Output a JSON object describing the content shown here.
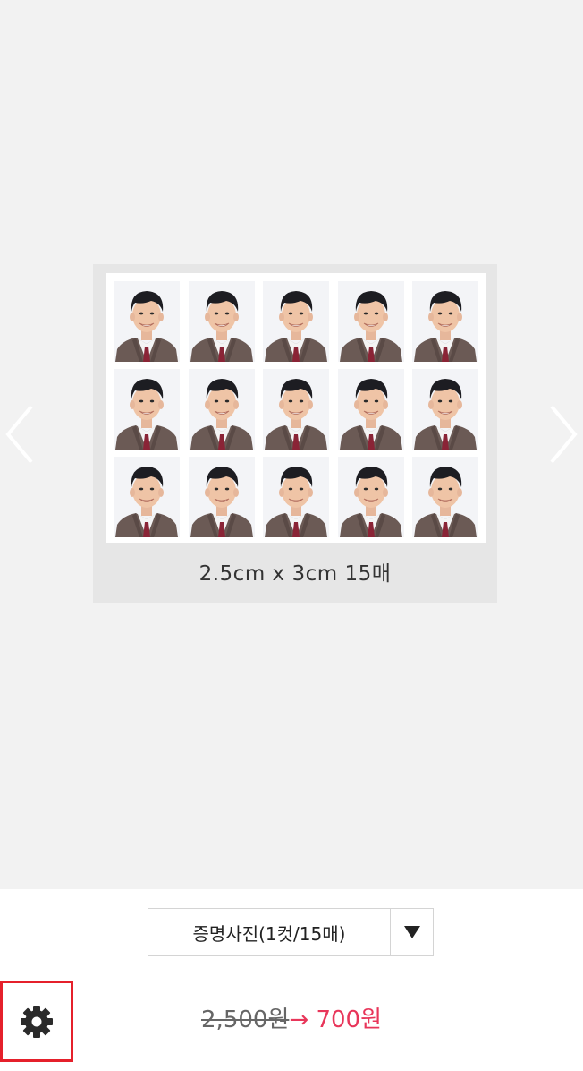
{
  "preview": {
    "caption": "2.5cm x 3cm 15매",
    "photo_count": 15,
    "prev_icon": "chevron-left-icon",
    "next_icon": "chevron-right-icon"
  },
  "product_select": {
    "value": "증명사진(1컷/15매)",
    "arrow_icon": "triangle-down-icon"
  },
  "settings": {
    "icon": "gear-icon"
  },
  "price": {
    "original": "2,500원",
    "arrow": "→",
    "sale": "700원"
  },
  "colors": {
    "accent": "#e8365a",
    "highlight_border": "#e5202b",
    "background": "#f2f2f2"
  }
}
